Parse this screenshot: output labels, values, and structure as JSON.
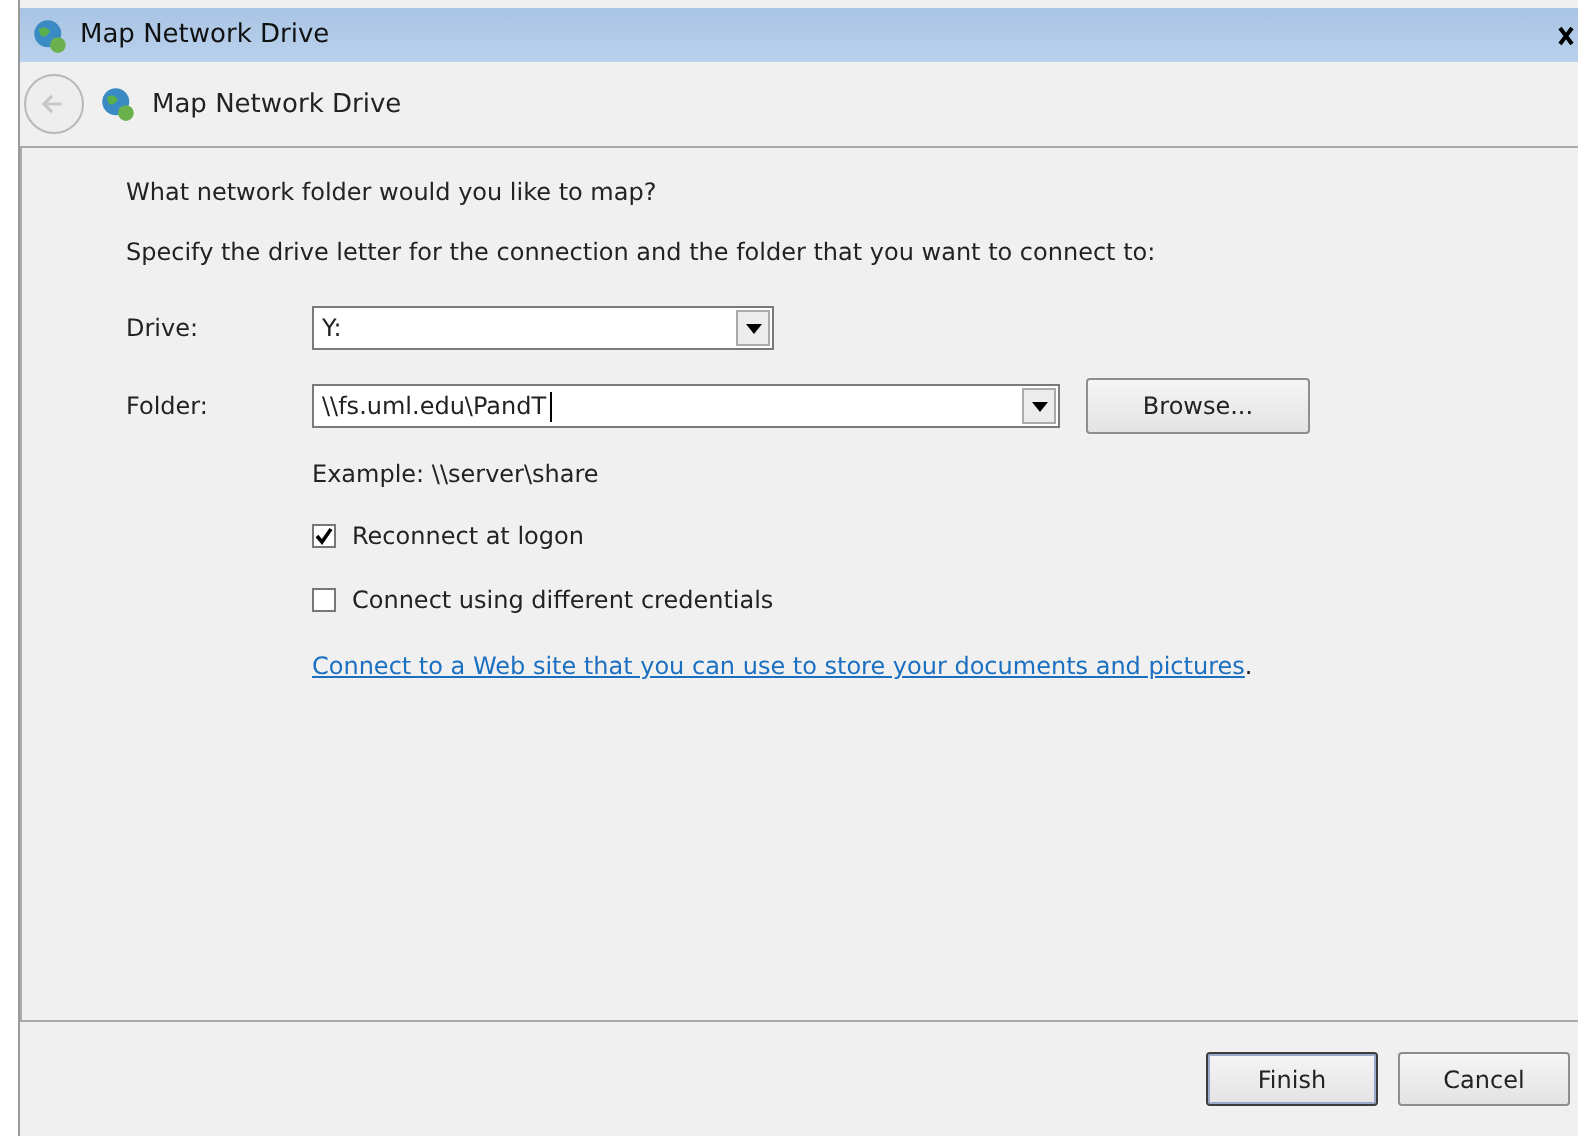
{
  "window": {
    "title": "Map Network Drive"
  },
  "nav": {
    "title": "Map Network Drive",
    "back_disabled": true
  },
  "heading": "What network folder would you like to map?",
  "instruction": "Specify the drive letter for the connection and the folder that you want to connect to:",
  "drive": {
    "label": "Drive:",
    "value": "Y:"
  },
  "folder": {
    "label": "Folder:",
    "value": "\\\\fs.uml.edu\\PandT",
    "browse": "Browse..."
  },
  "example": "Example: \\\\server\\share",
  "options": [
    {
      "label": "Reconnect at logon",
      "checked": true
    },
    {
      "label": "Connect using different credentials",
      "checked": false
    }
  ],
  "link": "Connect to a Web site that you can use to store your documents and pictures",
  "link_suffix": ".",
  "buttons": [
    {
      "label": "Finish",
      "default": true
    },
    {
      "label": "Cancel",
      "default": false
    }
  ]
}
